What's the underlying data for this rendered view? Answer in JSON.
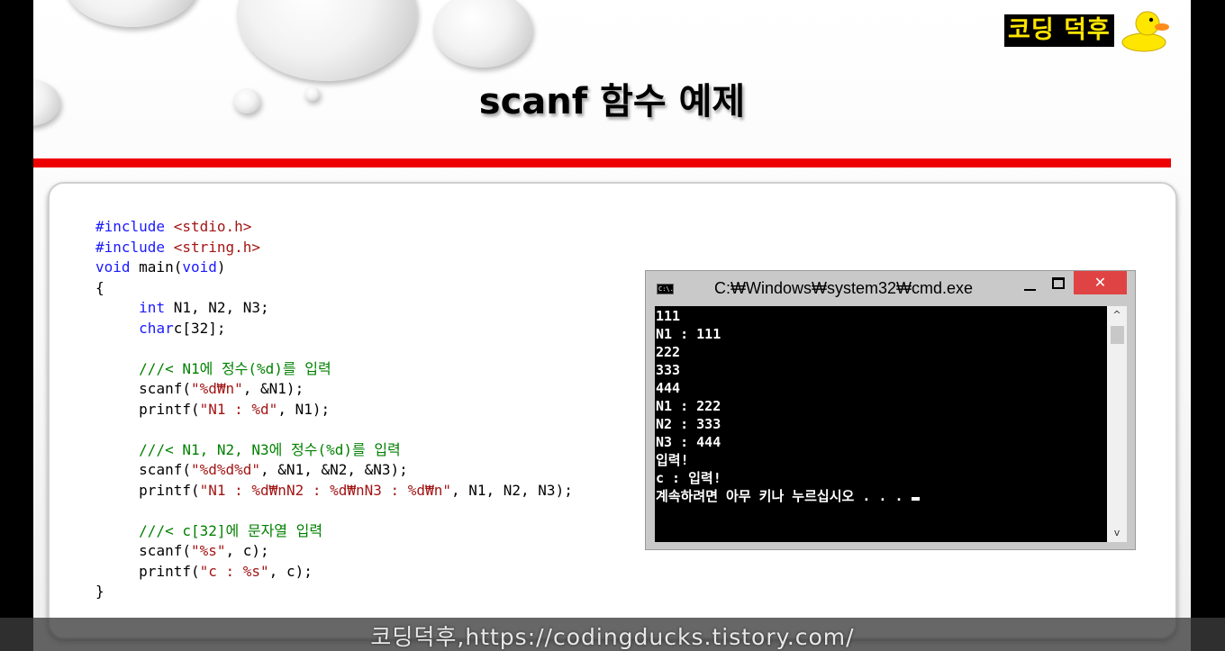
{
  "slide": {
    "title": "scanf 함수 예제",
    "logo_text": "코딩 덕후",
    "footer_text": "코딩덕후,https://codingducks.tistory.com/"
  },
  "code": [
    "#include <stdio.h>",
    "#include <string.h>",
    "void main(void)",
    "{",
    "int N1, N2, N3;",
    "charc[32];",
    "",
    "///< N1에 정수(%d)를 입력",
    "scanf(\"%d₩n\", &N1);",
    "printf(\"N1 : %d\", N1);",
    "",
    "///< N1, N2, N3에 정수(%d)를 입력",
    "scanf(\"%d%d%d\", &N1, &N2, &N3);",
    "printf(\"N1 : %d₩nN2 : %d₩nN3 : %d₩n\", N1, N2, N3);",
    "",
    "///< c[32]에 문자열 입력",
    "scanf(\"%s\", c);",
    "printf(\"c : %s\", c);",
    "}"
  ],
  "cmd_window": {
    "icon_text": "C:\\.",
    "title": "C:₩Windows₩system32₩cmd.exe",
    "close_symbol": "✕",
    "output_lines": [
      "111",
      "N1 : 111",
      "222",
      "333",
      "444",
      "N1 : 222",
      "N2 : 333",
      "N3 : 444",
      "입력!",
      "c : 입력!",
      "계속하려면 아무 키나 누르십시오 . . . "
    ],
    "scroll_up": "^",
    "scroll_down": "v"
  }
}
